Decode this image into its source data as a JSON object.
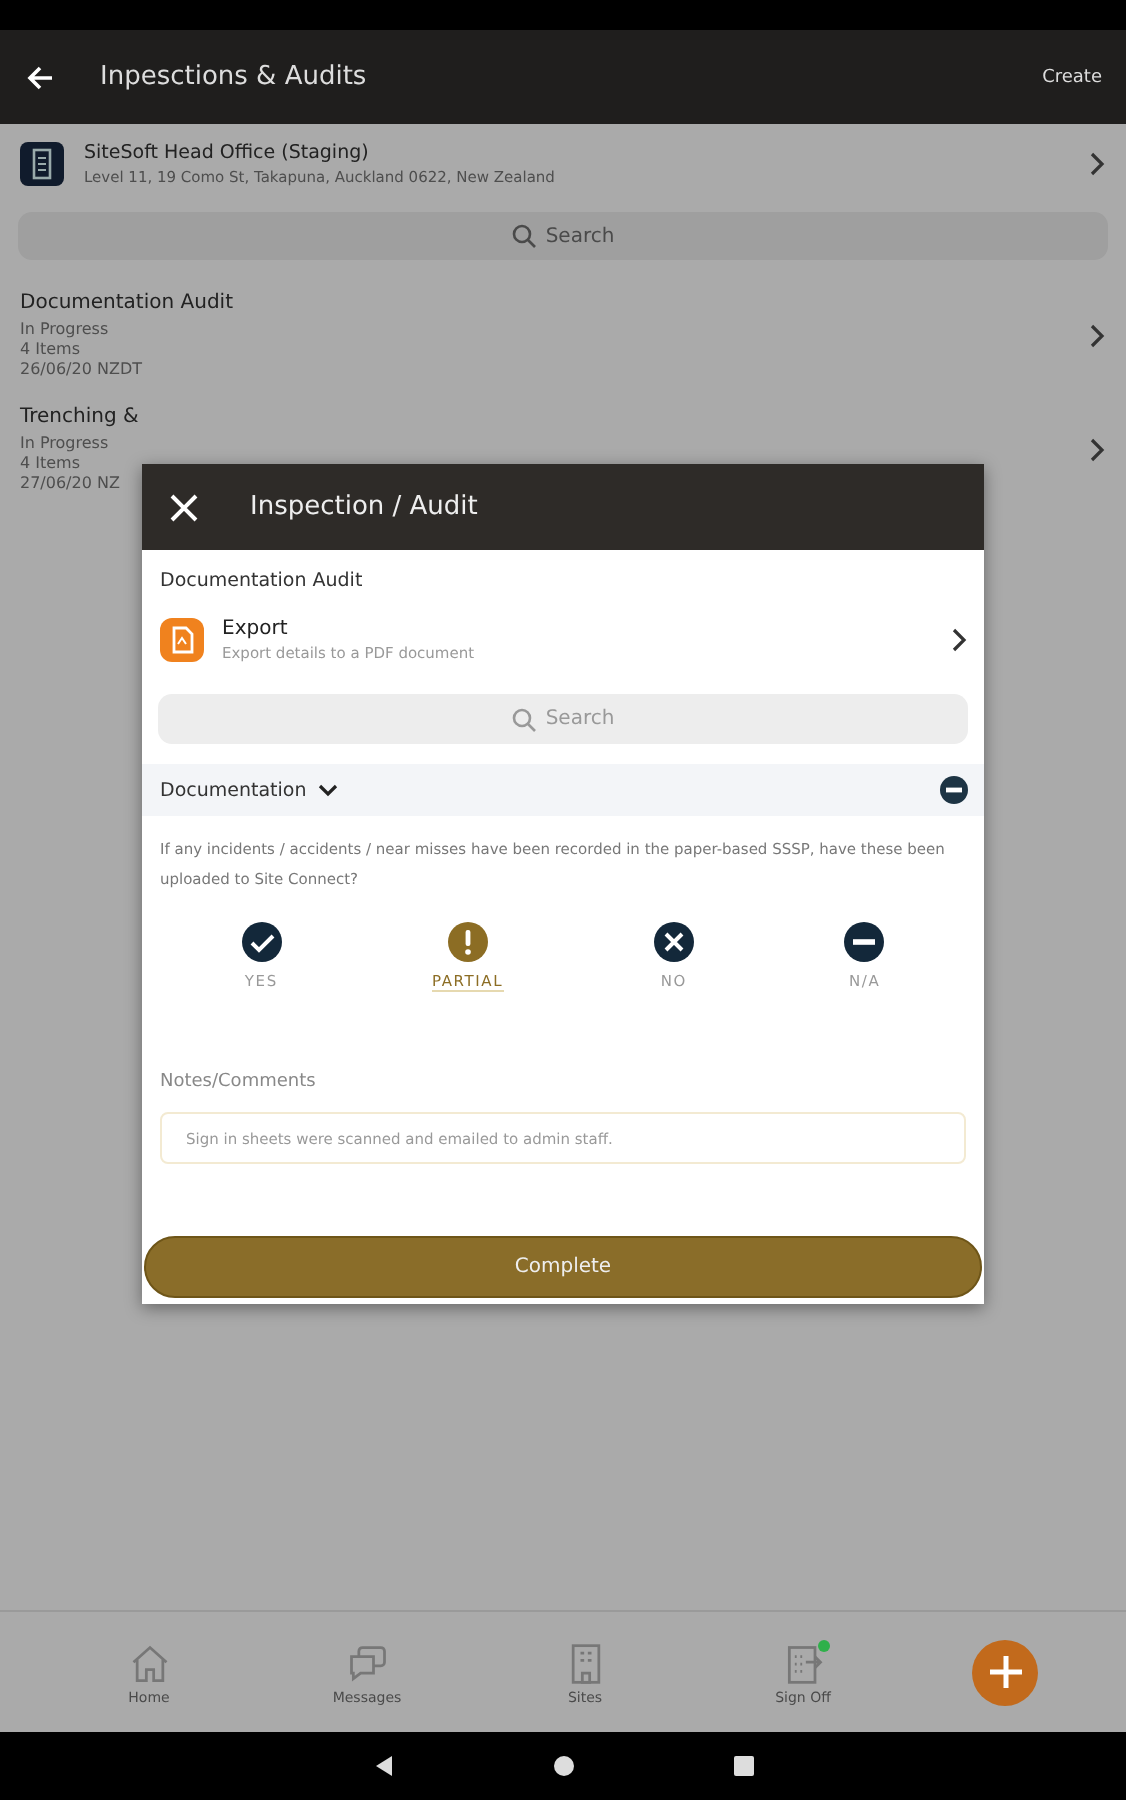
{
  "app_bar": {
    "title": "Inpesctions & Audits",
    "action": "Create"
  },
  "site": {
    "name": "SiteSoft Head Office (Staging)",
    "address": "Level 11, 19 Como St, Takapuna, Auckland 0622, New Zealand"
  },
  "search": {
    "placeholder": "Search"
  },
  "audits": [
    {
      "title": "Documentation Audit",
      "status": "In Progress",
      "count": "4 Items",
      "date": "26/06/20 NZDT"
    },
    {
      "title": "Trenching &",
      "status": "In Progress",
      "count": "4 Items",
      "date": "27/06/20 NZ"
    }
  ],
  "dialog": {
    "title": "Inspection / Audit",
    "subtitle": "Documentation Audit",
    "export": {
      "title": "Export",
      "description": "Export details to a PDF document"
    },
    "search": {
      "placeholder": "Search"
    },
    "section": {
      "title": "Documentation",
      "expanded": true
    },
    "question": "If any incidents / accidents / near misses have been recorded in the paper-based SSSP, have these been uploaded to Site Connect?",
    "options": [
      {
        "kind": "yes",
        "label": "YES",
        "selected": false
      },
      {
        "kind": "partial",
        "label": "PARTIAL",
        "selected": true
      },
      {
        "kind": "no",
        "label": "NO",
        "selected": false
      },
      {
        "kind": "na",
        "label": "N/A",
        "selected": false
      }
    ],
    "notes_label": "Notes/Comments",
    "notes_value": "Sign in sheets were scanned and emailed to admin staff.",
    "button": "Complete"
  },
  "nav": [
    {
      "kind": "home",
      "label": "Home",
      "notification": false
    },
    {
      "kind": "messages",
      "label": "Messages",
      "notification": false
    },
    {
      "kind": "sites",
      "label": "Sites",
      "notification": false
    },
    {
      "kind": "signoff",
      "label": "Sign Off",
      "notification": true
    }
  ]
}
